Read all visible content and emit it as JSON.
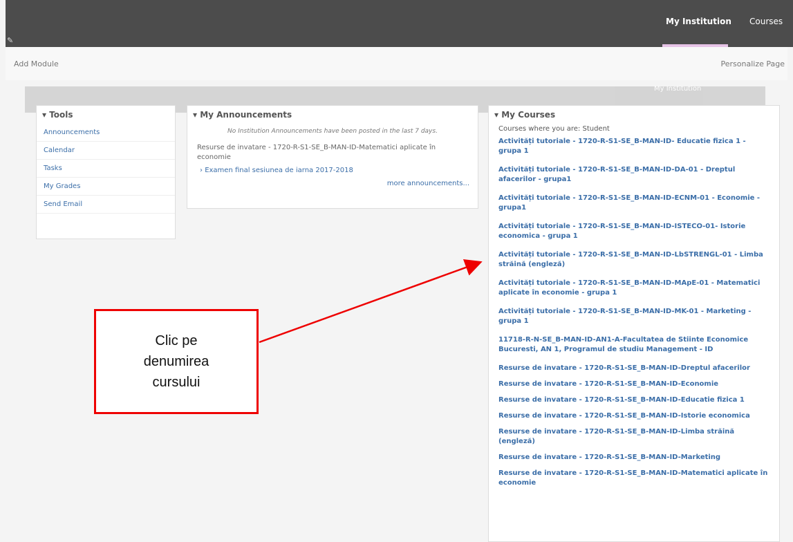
{
  "topbar": {
    "my_institution": "My Institution",
    "courses": "Courses"
  },
  "page": {
    "add_module": "Add Module",
    "personalize": "Personalize Page",
    "band_label": "My Institution"
  },
  "tools": {
    "title": "Tools",
    "items": [
      "Announcements",
      "Calendar",
      "Tasks",
      "My Grades",
      "Send Email"
    ]
  },
  "announcements": {
    "title": "My Announcements",
    "note": "No Institution Announcements have been posted in the last 7 days.",
    "resource": "Resurse de invatare - 1720-R-S1-SE_B-MAN-ID-Matematici aplicate în economie",
    "exam": "Examen final sesiunea de iarna 2017-2018",
    "more": "more announcements..."
  },
  "my_courses": {
    "title": "My Courses",
    "subtitle": "Courses where you are: Student",
    "items": [
      "Activități tutoriale - 1720-R-S1-SE_B-MAN-ID- Educatie fizica 1 - grupa 1",
      "Activități tutoriale - 1720-R-S1-SE_B-MAN-ID-DA-01 - Dreptul afacerilor - grupa1",
      "Activități tutoriale - 1720-R-S1-SE_B-MAN-ID-ECNM-01 - Economie - grupa1",
      "Activități tutoriale - 1720-R-S1-SE_B-MAN-ID-ISTECO-01- Istorie economica - grupa 1",
      "Activități tutoriale - 1720-R-S1-SE_B-MAN-ID-LbSTRENGL-01 - Limba străină (engleză)",
      "Activități tutoriale - 1720-R-S1-SE_B-MAN-ID-MApE-01 - Matematici aplicate în economie - grupa 1",
      "Activități tutoriale - 1720-R-S1-SE_B-MAN-ID-MK-01 - Marketing - grupa 1",
      "11718-R-N-SE_B-MAN-ID-AN1-A-Facultatea de Stiinte Economice Bucuresti, AN 1, Programul de studiu Management - ID",
      "Resurse de invatare - 1720-R-S1-SE_B-MAN-ID-Dreptul afacerilor",
      "Resurse de invatare - 1720-R-S1-SE_B-MAN-ID-Economie",
      "Resurse de invatare - 1720-R-S1-SE_B-MAN-ID-Educatie fizica 1",
      "Resurse de invatare - 1720-R-S1-SE_B-MAN-ID-Istorie economica",
      "Resurse de invatare - 1720-R-S1-SE_B-MAN-ID-Limba străină (engleză)",
      "Resurse de invatare - 1720-R-S1-SE_B-MAN-ID-Marketing",
      "Resurse de invatare - 1720-R-S1-SE_B-MAN-ID-Matematici aplicate în economie"
    ]
  },
  "callout": {
    "text": "Clic pe denumirea cursului"
  },
  "colors": {
    "topbar": "#4c4c4c",
    "link": "#3b6ea8",
    "callout": "#ee0000"
  },
  "icons": {
    "edit": "pencil-icon"
  }
}
